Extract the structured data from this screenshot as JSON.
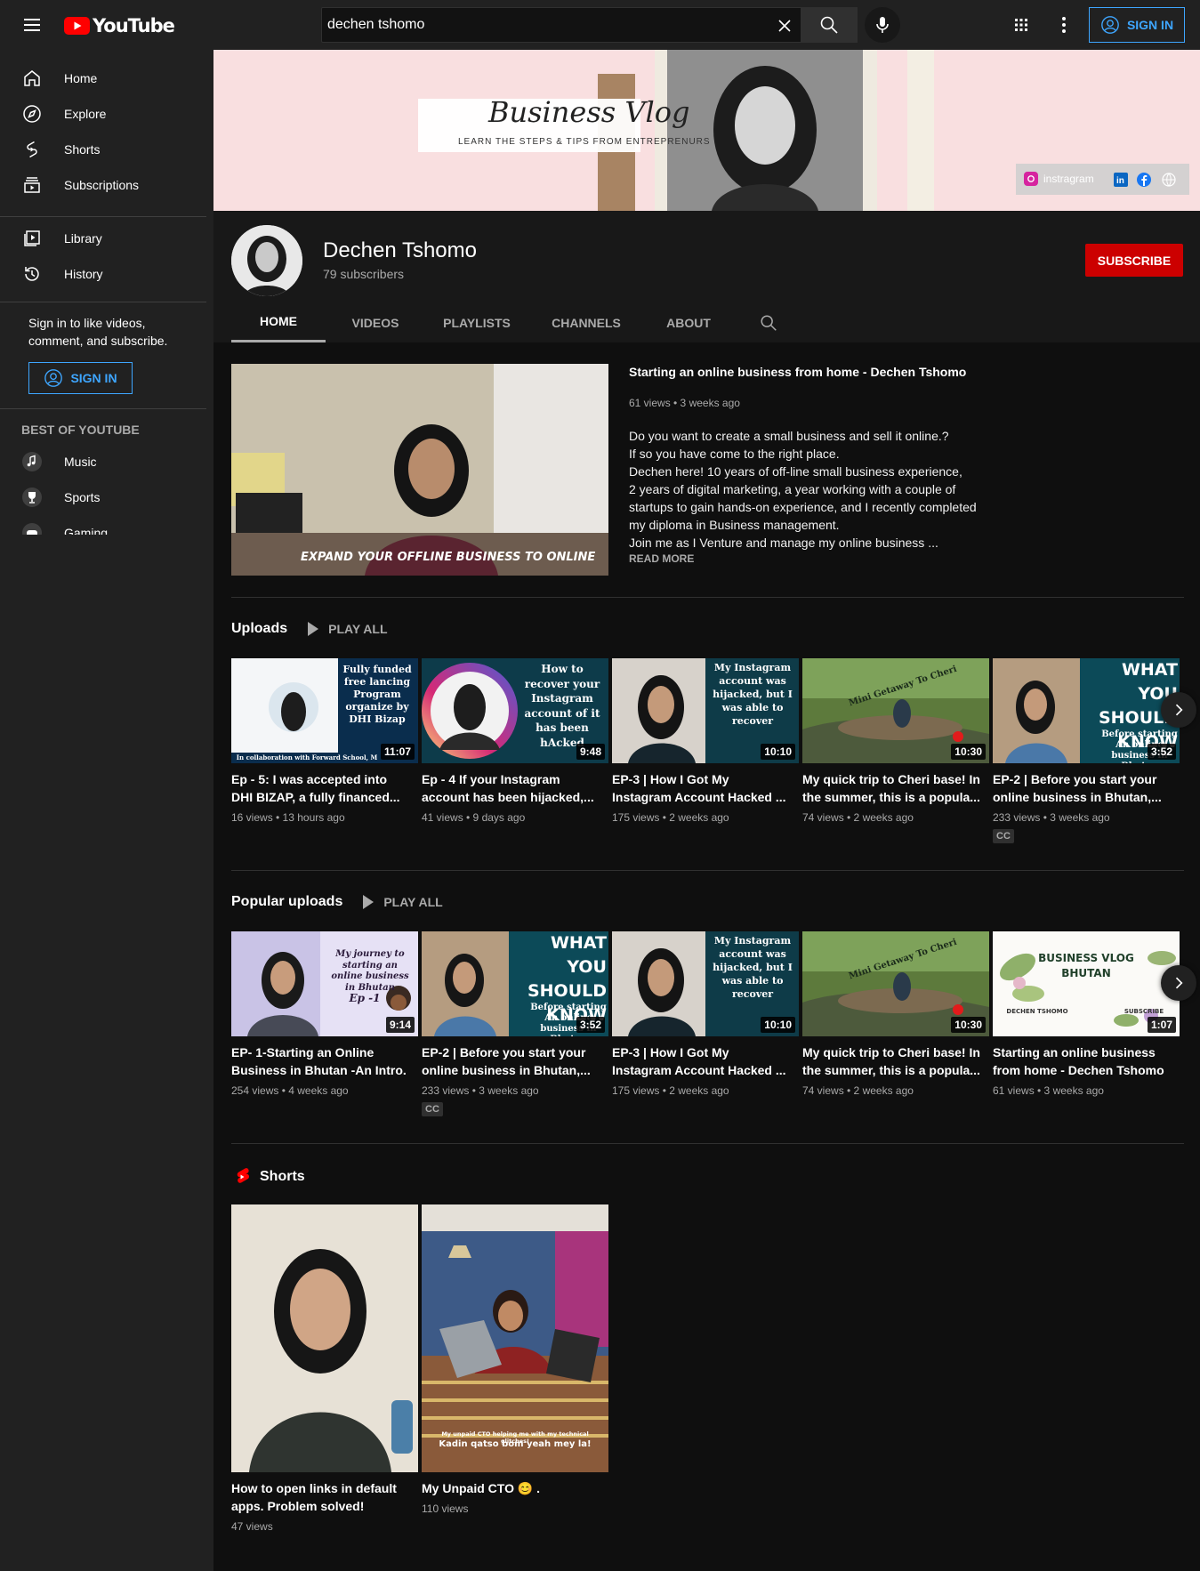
{
  "header": {
    "logo_text": "YouTube",
    "search_value": "dechen tshomo",
    "signin_label": "SIGN IN"
  },
  "sidebar": {
    "items": [
      {
        "label": "Home",
        "icon": "home-icon"
      },
      {
        "label": "Explore",
        "icon": "compass-icon"
      },
      {
        "label": "Shorts",
        "icon": "shorts-icon"
      },
      {
        "label": "Subscriptions",
        "icon": "subscriptions-icon"
      },
      {
        "label": "Library",
        "icon": "library-icon"
      },
      {
        "label": "History",
        "icon": "history-icon"
      }
    ],
    "signin_prompt": "Sign in to like videos, comment, and subscribe.",
    "signin_label": "SIGN IN",
    "best_heading": "BEST OF YOUTUBE",
    "best_items": [
      {
        "label": "Music",
        "icon": "music-icon"
      },
      {
        "label": "Sports",
        "icon": "trophy-icon"
      },
      {
        "label": "Gaming",
        "icon": "gaming-icon"
      }
    ]
  },
  "banner": {
    "title": "Business Vlog",
    "tagline": "LEARN THE STEPS & TIPS FROM ENTREPRENURS",
    "instagram_label": "instragram"
  },
  "channel": {
    "name": "Dechen Tshomo",
    "subscribers": "79 subscribers",
    "subscribe_label": "SUBSCRIBE",
    "tabs": [
      "HOME",
      "VIDEOS",
      "PLAYLISTS",
      "CHANNELS",
      "ABOUT"
    ]
  },
  "featured": {
    "title": "Starting an online business from home - Dechen Tshomo",
    "meta": "61 views • 3 weeks ago",
    "description": "Do you want to create a small business and sell it online.?\n If so you have come to the right place.\nDechen here! 10 years of off-line small business experience,\n2 years of digital marketing, a year working with a couple of\nstartups to gain hands-on experience, and I recently completed\nmy diploma in Business management.\nJoin me as I Venture and manage my online business ...",
    "read_more": "READ MORE",
    "thumb_caption": "Expand your offline business to online"
  },
  "uploads": {
    "title": "Uploads",
    "play_all": "PLAY ALL",
    "videos": [
      {
        "title": "Ep - 5: I was accepted into DHI BIZAP, a fully financed...",
        "meta": "16 views • 13 hours ago",
        "duration": "11:07",
        "thumb_text": "Fully funded free lancing Program organize by DHI Bizap",
        "footer": "In collaboration with Forward School, M"
      },
      {
        "title": "Ep - 4 If your Instagram account has been hijacked,...",
        "meta": "41 views • 9 days ago",
        "duration": "9:48",
        "thumb_text": "How to recover your Instagram account of it has been hAcked"
      },
      {
        "title": "EP-3 | How I Got My Instagram Account Hacked ...",
        "meta": "175 views • 2 weeks ago",
        "duration": "10:10",
        "thumb_text": "My Instagram account was hijacked, but I was able to recover"
      },
      {
        "title": "My quick trip to Cheri base! In the summer, this is a popula...",
        "meta": "74 views • 2 weeks ago",
        "duration": "10:30",
        "thumb_text": "Mini Getaway To Cheri"
      },
      {
        "title": "EP-2 | Before you start your online business in Bhutan,...",
        "meta": "233 views • 3 weeks ago",
        "duration": "3:52",
        "thumb_text": "WHAT YOU SHOULD KNOW",
        "thumb_sub": "Before starting An online business in Bhutan",
        "cc": "CC"
      }
    ]
  },
  "popular": {
    "title": "Popular uploads",
    "play_all": "PLAY ALL",
    "videos": [
      {
        "title": "EP- 1-Starting an Online Business in Bhutan -An Intro.",
        "meta": "254 views • 4 weeks ago",
        "duration": "9:14",
        "thumb_text": "My journey to starting an online business in Bhutan",
        "thumb_sub": "Ep -1"
      },
      {
        "title": "EP-2 | Before you start your online business in Bhutan,...",
        "meta": "233 views • 3 weeks ago",
        "duration": "3:52",
        "thumb_text": "WHAT YOU SHOULD KNOW",
        "thumb_sub": "Before starting An online business in Bhutan",
        "cc": "CC"
      },
      {
        "title": "EP-3 | How I Got My Instagram Account Hacked ...",
        "meta": "175 views • 2 weeks ago",
        "duration": "10:10",
        "thumb_text": "My Instagram account was hijacked, but I was able to recover"
      },
      {
        "title": "My quick trip to Cheri base! In the summer, this is a popula...",
        "meta": "74 views • 2 weeks ago",
        "duration": "10:30",
        "thumb_text": "Mini Getaway To Cheri"
      },
      {
        "title": "Starting an online business from home - Dechen Tshomo",
        "meta": "61 views • 3 weeks ago",
        "duration": "1:07",
        "thumb_text": "BUSINESS VLOG BHUTAN",
        "thumb_left": "DECHEN TSHOMO",
        "thumb_right": "SUBSCRIBE"
      }
    ]
  },
  "shorts": {
    "title": "Shorts",
    "items": [
      {
        "title": "How to open links in default apps. Problem solved!",
        "meta": "47 views"
      },
      {
        "title": "My Unpaid CTO 😊 .",
        "meta": "110 views",
        "caption_small": "My unpaid CTO helping me with my technical glitches!",
        "caption": "Kadin qatso bom  yeah mey la!"
      }
    ]
  },
  "colors": {
    "accent_blue": "#3ea6ff",
    "subscribe_red": "#cc0000",
    "bg_dark": "#0f0f0f",
    "panel": "#212121"
  }
}
